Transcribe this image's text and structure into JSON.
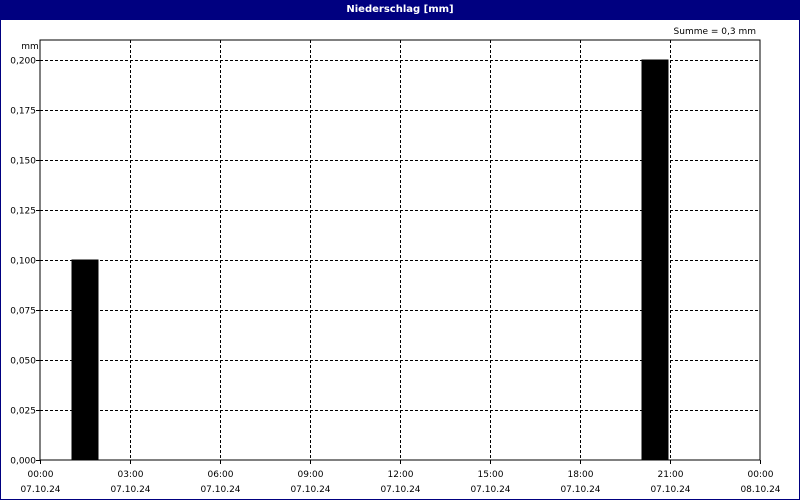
{
  "window": {
    "title": "Niederschlag [mm]"
  },
  "summary": {
    "text": "Summe = 0,3 mm"
  },
  "chart_data": {
    "type": "bar",
    "title": "Niederschlag [mm]",
    "ylabel": "mm",
    "xlabel": "",
    "ylim": [
      0,
      0.2
    ],
    "x_range": [
      "2024-10-07T00:00",
      "2024-10-08T00:00"
    ],
    "y_ticks": [
      "0,000",
      "0,025",
      "0,050",
      "0,075",
      "0,100",
      "0,125",
      "0,150",
      "0,175",
      "0,200"
    ],
    "x_ticks": [
      {
        "time": "00:00",
        "date": "07.10.24",
        "hours": 0
      },
      {
        "time": "03:00",
        "date": "07.10.24",
        "hours": 3
      },
      {
        "time": "06:00",
        "date": "07.10.24",
        "hours": 6
      },
      {
        "time": "09:00",
        "date": "07.10.24",
        "hours": 9
      },
      {
        "time": "12:00",
        "date": "07.10.24",
        "hours": 12
      },
      {
        "time": "15:00",
        "date": "07.10.24",
        "hours": 15
      },
      {
        "time": "18:00",
        "date": "07.10.24",
        "hours": 18
      },
      {
        "time": "21:00",
        "date": "07.10.24",
        "hours": 21
      },
      {
        "time": "00:00",
        "date": "08.10.24",
        "hours": 24
      }
    ],
    "bars": [
      {
        "start": "2024-10-07T01:00",
        "end": "2024-10-07T02:00",
        "value": 0.1
      },
      {
        "start": "2024-10-07T20:00",
        "end": "2024-10-07T21:00",
        "value": 0.2
      }
    ],
    "bar_color": "#000000",
    "grid": true,
    "grid_style": "dashed"
  }
}
